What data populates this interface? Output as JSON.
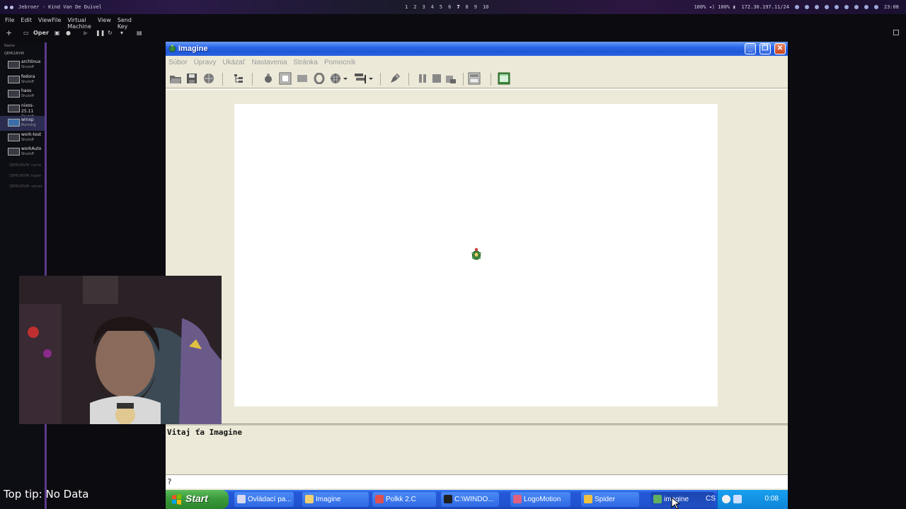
{
  "host_bar": {
    "window_title": "Jebroer - Kind Van De Duivel",
    "workspaces": [
      "1",
      "2",
      "3",
      "4",
      "5",
      "6",
      "7",
      "8",
      "9",
      "10"
    ],
    "active_workspace": "7",
    "volume_text": "100% ◂) 100% ▮",
    "ip_text": "172.30.197.11/24",
    "time": "23:08"
  },
  "vm_manager": {
    "menu": [
      "File",
      "Edit",
      "View"
    ],
    "submenu": [
      "File",
      "Virtual Machine",
      "View",
      "Send Key"
    ],
    "toolbar": {
      "open_label": "Oper"
    },
    "list_header": "Name",
    "group_label": "QEMU/KVM",
    "vms": [
      {
        "name": "archlinux",
        "status": "Shutoff"
      },
      {
        "name": "fedora",
        "status": "Shutoff"
      },
      {
        "name": "haos",
        "status": "Shutoff"
      },
      {
        "name": "nixos-25.11",
        "status": "Shutoff"
      },
      {
        "name": "winxp",
        "status": "Running"
      },
      {
        "name": "work-test",
        "status": "Shutoff"
      },
      {
        "name": "workAuto",
        "status": "Shutoff"
      }
    ],
    "connections": [
      "QEMU/KVM: corne",
      "QEMU/KVM: hyper",
      "QEMU/KVM: server"
    ]
  },
  "imagine": {
    "title": "Imagine",
    "menu": [
      "Súbor",
      "Úpravy",
      "Ukázať",
      "Nastavenia",
      "Stránka",
      "Pomocník"
    ],
    "output_message": "Vitaj ťa Imagine",
    "command_prompt": "?"
  },
  "taskbar": {
    "start_label": "Start",
    "tasks": [
      {
        "label": "Ovládací pa...",
        "icon_color": "#d8d8f0"
      },
      {
        "label": "Imagine",
        "icon_color": "#f0d070"
      },
      {
        "label": "Polkk 2.C",
        "icon_color": "#e05050"
      },
      {
        "label": "C:\\WINDO...",
        "icon_color": "#202020"
      },
      {
        "label": "LogoMotion",
        "icon_color": "#e06080"
      },
      {
        "label": "Spider",
        "icon_color": "#f0c040"
      },
      {
        "label": "imagine",
        "icon_color": "#60b060"
      }
    ],
    "language": "CS",
    "clock": "0:08"
  },
  "overlay": {
    "tip_text": "Top tip: No Data"
  }
}
